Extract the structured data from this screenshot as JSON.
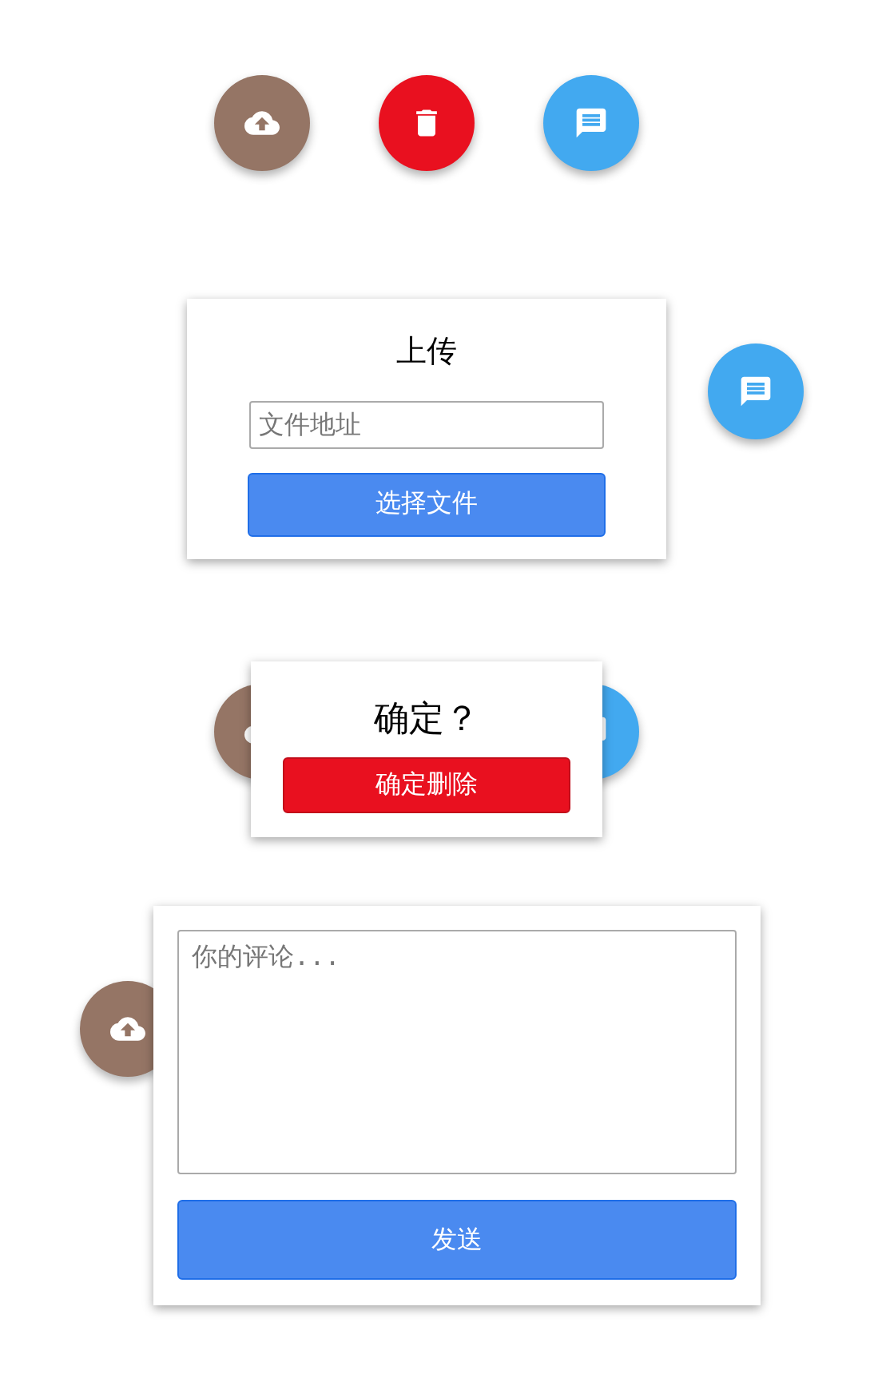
{
  "fab_bar": [
    {
      "kind": "upload",
      "color": "#957565"
    },
    {
      "kind": "delete",
      "color": "#e9101f"
    },
    {
      "kind": "comment",
      "color": "#42a9f0"
    }
  ],
  "upload_popover": {
    "title": "上传",
    "file_field": {
      "placeholder": "文件地址"
    },
    "button": "选择文件",
    "side_fab": {
      "kind": "comment",
      "color": "#42a9f0"
    }
  },
  "delete_popover": {
    "title": "确定？",
    "button": "确定删除",
    "behind_fabs": [
      {
        "kind": "upload",
        "color": "#957565"
      },
      {
        "kind": "comment",
        "color": "#42a9f0"
      }
    ]
  },
  "comment_popover": {
    "comment_field": {
      "placeholder": "你的评论..."
    },
    "button": "发送",
    "side_fab": {
      "kind": "upload",
      "color": "#957565"
    }
  }
}
